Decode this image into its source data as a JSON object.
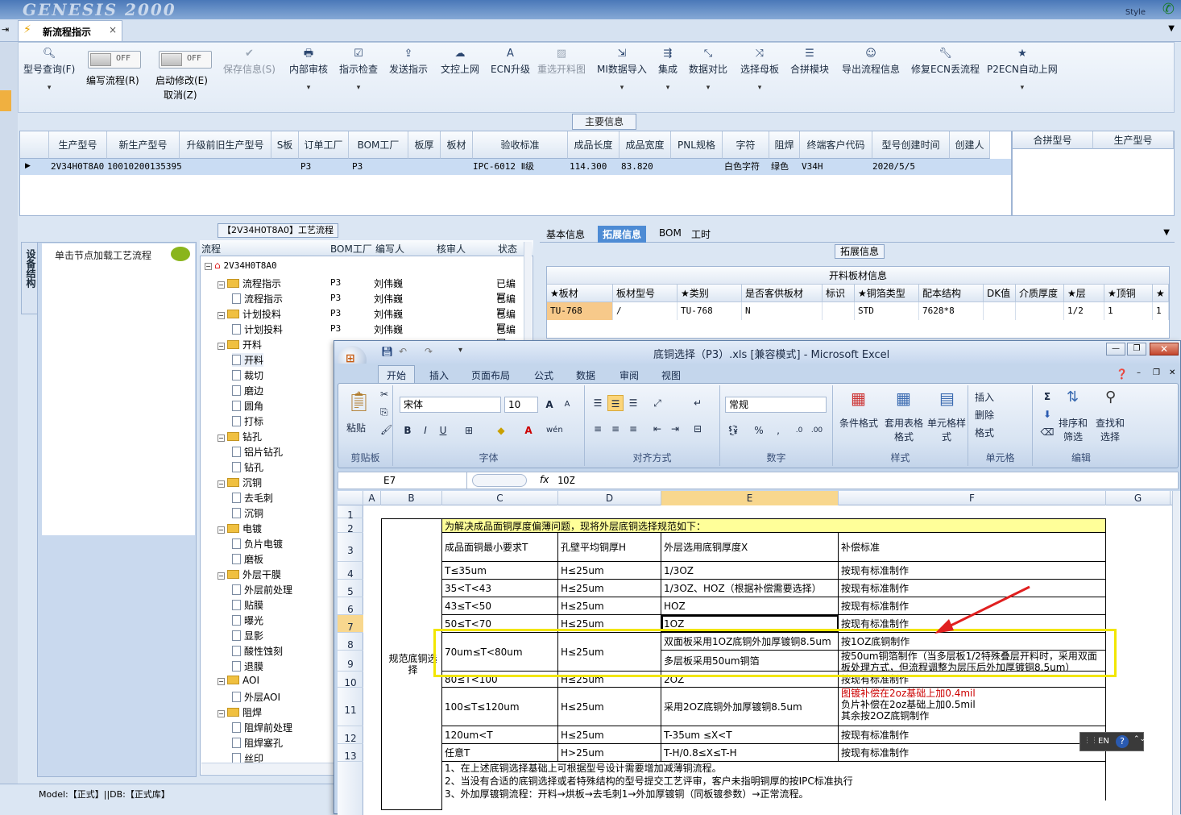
{
  "app": {
    "banner_logo": "GENESIS 2000",
    "style_label": "Style",
    "tab_title": "新流程指示",
    "tab_close": "×"
  },
  "toolbar": {
    "query": "型号查询(F)",
    "edit_flow": "编写流程(R)",
    "start_modify": "启动修改(E)",
    "cancel": "取消(Z)",
    "off": "OFF",
    "save": "保存信息(S)",
    "internal_review": "内部审核",
    "check": "指示检查",
    "publish": "发送指示",
    "upload": "文控上网",
    "ecn_upgrade": "ECN升级",
    "reselect": "重选开料图",
    "mi_import": "MI数据导入",
    "integrate": "集成",
    "compare": "数据对比",
    "choose_mother": "选择母板",
    "combine": "合拼模块",
    "export": "导出流程信息",
    "fix_ecn": "修复ECN丢流程",
    "p2ecn": "P2ECN自动上网"
  },
  "main_info": {
    "label": "主要信息",
    "headers": [
      "生产型号",
      "新生产型号",
      "升级前旧生产型号",
      "S板",
      "订单工厂",
      "BOM工厂",
      "板厚",
      "板材",
      "验收标准",
      "成品长度",
      "成品宽度",
      "PNL规格",
      "字符",
      "阻焊",
      "终端客户代码",
      "型号创建时间",
      "创建人"
    ],
    "row": [
      "2V34H0T8A0",
      "10010200135395",
      "",
      "",
      "P3",
      "P3",
      "",
      "",
      "IPC-6012 Ⅱ级",
      "114.300",
      "83.820",
      "",
      "白色字符",
      "绿色",
      "V34H",
      "2020/5/5",
      ""
    ],
    "side_headers": [
      "合拼型号",
      "生产型号"
    ]
  },
  "left": {
    "side_tab": "设备结构",
    "load_hint": "单击节点加载工艺流程"
  },
  "flow": {
    "title": "【2V34H0T8A0】工艺流程",
    "headers": [
      "流程",
      "BOM工厂",
      "编写人",
      "核审人",
      "状态"
    ],
    "root": "2V34H0T8A0",
    "rows": [
      {
        "name": "流程指示",
        "type": "folder",
        "bom": "P3",
        "writer": "刘伟巍",
        "status": "已编写"
      },
      {
        "name": "流程指示",
        "type": "doc",
        "bom": "P3",
        "writer": "刘伟巍",
        "status": "已编写"
      },
      {
        "name": "计划投料",
        "type": "folder",
        "bom": "P3",
        "writer": "刘伟巍",
        "status": "已编写"
      },
      {
        "name": "计划投料",
        "type": "doc",
        "bom": "P3",
        "writer": "刘伟巍",
        "status": "已编写"
      },
      {
        "name": "开料",
        "type": "folder",
        "bom": "",
        "writer": "",
        "status": ""
      },
      {
        "name": "开料",
        "type": "doc",
        "bom": "",
        "writer": "",
        "status": ""
      },
      {
        "name": "裁切",
        "type": "doc",
        "bom": "",
        "writer": "",
        "status": ""
      },
      {
        "name": "磨边",
        "type": "doc",
        "bom": "",
        "writer": "",
        "status": ""
      },
      {
        "name": "圆角",
        "type": "doc",
        "bom": "",
        "writer": "",
        "status": ""
      },
      {
        "name": "打标",
        "type": "doc",
        "bom": "",
        "writer": "",
        "status": ""
      },
      {
        "name": "钻孔",
        "type": "folder",
        "bom": "",
        "writer": "",
        "status": ""
      },
      {
        "name": "铝片钻孔",
        "type": "doc",
        "bom": "",
        "writer": "",
        "status": ""
      },
      {
        "name": "钻孔",
        "type": "doc",
        "bom": "",
        "writer": "",
        "status": ""
      },
      {
        "name": "沉铜",
        "type": "folder",
        "bom": "",
        "writer": "",
        "status": ""
      },
      {
        "name": "去毛刺",
        "type": "doc",
        "bom": "",
        "writer": "",
        "status": ""
      },
      {
        "name": "沉铜",
        "type": "doc",
        "bom": "",
        "writer": "",
        "status": ""
      },
      {
        "name": "电镀",
        "type": "folder",
        "bom": "",
        "writer": "",
        "status": ""
      },
      {
        "name": "负片电镀",
        "type": "doc",
        "bom": "",
        "writer": "",
        "status": ""
      },
      {
        "name": "磨板",
        "type": "doc",
        "bom": "",
        "writer": "",
        "status": ""
      },
      {
        "name": "外层干膜",
        "type": "folder",
        "bom": "",
        "writer": "",
        "status": ""
      },
      {
        "name": "外层前处理",
        "type": "doc",
        "bom": "",
        "writer": "",
        "status": ""
      },
      {
        "name": "贴膜",
        "type": "doc",
        "bom": "",
        "writer": "",
        "status": ""
      },
      {
        "name": "曝光",
        "type": "doc",
        "bom": "",
        "writer": "",
        "status": ""
      },
      {
        "name": "显影",
        "type": "doc",
        "bom": "",
        "writer": "",
        "status": ""
      },
      {
        "name": "酸性蚀刻",
        "type": "doc",
        "bom": "",
        "writer": "",
        "status": ""
      },
      {
        "name": "退膜",
        "type": "doc",
        "bom": "",
        "writer": "",
        "status": ""
      },
      {
        "name": "AOI",
        "type": "folder",
        "bom": "",
        "writer": "",
        "status": ""
      },
      {
        "name": "外层AOI",
        "type": "doc",
        "bom": "",
        "writer": "",
        "status": ""
      },
      {
        "name": "阻焊",
        "type": "folder",
        "bom": "",
        "writer": "",
        "status": ""
      },
      {
        "name": "阻焊前处理",
        "type": "doc",
        "bom": "",
        "writer": "",
        "status": ""
      },
      {
        "name": "阻焊塞孔",
        "type": "doc",
        "bom": "",
        "writer": "",
        "status": ""
      },
      {
        "name": "丝印",
        "type": "doc",
        "bom": "",
        "writer": "",
        "status": ""
      }
    ]
  },
  "right": {
    "tabs": [
      "基本信息",
      "拓展信息",
      "BOM",
      "工时"
    ],
    "ext_label": "拓展信息",
    "grid_caption": "开料板材信息",
    "headers": [
      "★板材",
      "板材型号",
      "★类别",
      "是否客供板材",
      "标识",
      "★铜箔类型",
      "配本结构",
      "DK值",
      "介质厚度",
      "★层",
      "★顶铜",
      "★"
    ],
    "row": [
      "TU-768",
      "/",
      "TU-768",
      "N",
      "",
      "STD",
      "7628*8",
      "",
      "",
      "1/2",
      "1",
      "1"
    ]
  },
  "status": {
    "text": "Model:【正式】||DB:【正式库】"
  },
  "excel": {
    "title": "底铜选择（P3）.xls  [兼容模式] - Microsoft Excel",
    "tabs": [
      "开始",
      "插入",
      "页面布局",
      "公式",
      "数据",
      "审阅",
      "视图"
    ],
    "clipboard": {
      "paste": "粘贴",
      "group": "剪贴板"
    },
    "font": {
      "name": "宋体",
      "size": "10",
      "group": "字体"
    },
    "align_group": "对齐方式",
    "number": {
      "format": "常规",
      "group": "数字"
    },
    "styles": {
      "cond": "条件格式",
      "table": "套用表格格式",
      "cell": "单元格样式",
      "group": "样式"
    },
    "cells": {
      "insert": "插入",
      "delete": "删除",
      "format": "格式",
      "group": "单元格"
    },
    "edit": {
      "sort": "排序和筛选",
      "find": "查找和选择",
      "group": "编辑"
    },
    "namebox": "E7",
    "fx": "fx",
    "formula": "1OZ",
    "cols": [
      "A",
      "B",
      "C",
      "D",
      "E",
      "F",
      "G"
    ],
    "rows": [
      "1",
      "2",
      "3",
      "4",
      "5",
      "6",
      "7",
      "8",
      "9",
      "10",
      "11",
      "12",
      "13"
    ],
    "b_label": "规范底铜选择",
    "title_row": "为解决成品面铜厚度偏薄问题，现将外层底铜选择规范如下：",
    "header_row": [
      "成品面铜最小要求T",
      "孔壁平均铜厚H",
      "外层选用底铜厚度X",
      "补偿标准"
    ],
    "data": [
      [
        "T≤35um",
        "H≤25um",
        "1/3OZ",
        "按现有标准制作"
      ],
      [
        "35<T<43",
        "H≤25um",
        "1/3OZ、HOZ（根据补偿需要选择）",
        "按现有标准制作"
      ],
      [
        "43≤T<50",
        "H≤25um",
        "HOZ",
        "按现有标准制作"
      ],
      [
        "50≤T<70",
        "H≤25um",
        "1OZ",
        "按现有标准制作"
      ],
      [
        "70um≤T<80um",
        "H≤25um",
        "双面板采用1OZ底铜外加厚镀铜8.5um",
        "按1OZ底铜制作"
      ],
      [
        "",
        "",
        "多层板采用50um铜箔",
        "按50um铜箔制作（当多层板1/2特殊叠层开料时，采用双面板处理方式，但流程调整为层压后外加厚镀铜8.5um）"
      ],
      [
        "80≤T<100",
        "H≤25um",
        "2OZ",
        "按现有标准制作"
      ],
      [
        "100≤T≤120um",
        "H≤25um",
        "采用2OZ底铜外加厚镀铜8.5um",
        "图镀补偿在2oz基础上加0.4mil|负片补偿在2oz基础上加0.5mil|其余按2OZ底铜制作"
      ],
      [
        "120um<T",
        "H≤25um",
        "T-35um  ≤X<T",
        "按现有标准制作"
      ],
      [
        "任意T",
        "H>25um",
        "T-H/0.8≤X≤T-H",
        "按现有标准制作"
      ]
    ],
    "notes": [
      "1、在上述底铜选择基础上可根据型号设计需要增加减薄铜流程。",
      "2、当没有合适的底铜选择或者特殊结构的型号提交工艺评审，客户未指明铜厚的按IPC标准执行",
      "3、外加厚镀铜流程：开料→烘板→去毛刺1→外加厚镀铜（同板镀参数）→正常流程。"
    ],
    "lang": "EN",
    "colors": {
      "highlight": "#f2e600",
      "title_fill": "#ffff99",
      "red": "#cc0000"
    }
  }
}
